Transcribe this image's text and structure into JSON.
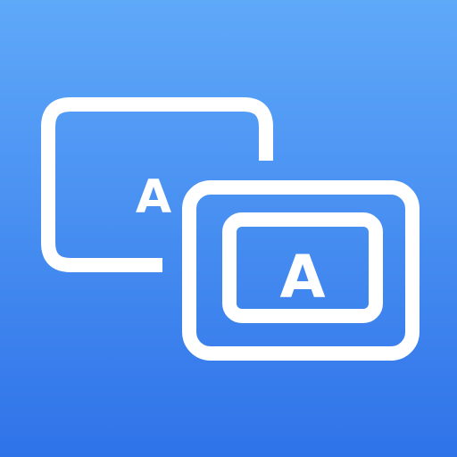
{
  "icon": {
    "name": "window-resize-text-icon",
    "background_top": "#5fa9f9",
    "background_bottom": "#2f73e9",
    "foreground": "#ffffff",
    "back_window_letter": "A",
    "front_window_letter": "A"
  }
}
